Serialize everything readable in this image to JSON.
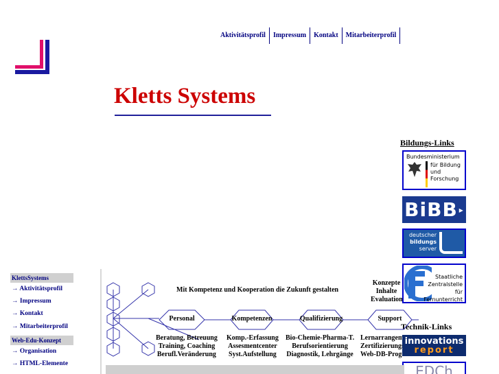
{
  "nav": {
    "items": [
      "Aktivitätsprofil",
      "Impressum",
      "Kontakt",
      "Mitarbeiterprofil"
    ]
  },
  "title": "Kletts Systems",
  "sidebar": {
    "head1": "KlettsSystems",
    "items1": [
      "→ Aktivitätsprofil",
      "→ Impressum",
      "→ Kontakt",
      "→ Mitarbeiterprofil"
    ],
    "head2": "Web-Edu-Konzept",
    "items2": [
      "→ Organisation",
      "→ HTML-Elemente"
    ]
  },
  "right": {
    "bildungs_heading": "Bildungs-Links",
    "bmbf_lines": [
      "Bundesministerium",
      "für Bildung",
      "und",
      "Forschung"
    ],
    "bibb": "BiBB",
    "dbs_lines": [
      "deutscher",
      "bildungs",
      "server"
    ],
    "zfu_lines": [
      "Staatliche",
      "Zentralstelle",
      "für",
      "Fernunterricht"
    ],
    "technik_heading": "Technik-Links",
    "innov_lines": [
      "innovations",
      "report"
    ],
    "edch": "EDCh"
  },
  "content": {
    "heading": "Mit Kompetenz und Kooperation die Zukunft gestalten",
    "hexes": [
      "Personal",
      "Kompetenzen",
      "Qualifizierung",
      "Support"
    ],
    "columns": [
      [
        "Beratung, Betreuung",
        "Training, Coaching",
        "Berufl.Veränderung"
      ],
      [
        "Komp.-Erfassung",
        "Assesmentcenter",
        "Syst.Aufstellung"
      ],
      [
        "Bio-Chemie-Pharma-T.",
        "Berufsorientierung",
        "Diagnostik, Lehrgänge"
      ],
      [
        "Lernarrangements",
        "Zertifizierungsstelle",
        "Web-DB-Programme"
      ]
    ],
    "konzept_lines": [
      "Konzepte",
      "Inhalte",
      "Evaluation"
    ]
  },
  "colors": {
    "nav": "#000080",
    "title": "#cc0000",
    "logo_pink": "#e0106a",
    "logo_blue": "#1a1aa0"
  }
}
